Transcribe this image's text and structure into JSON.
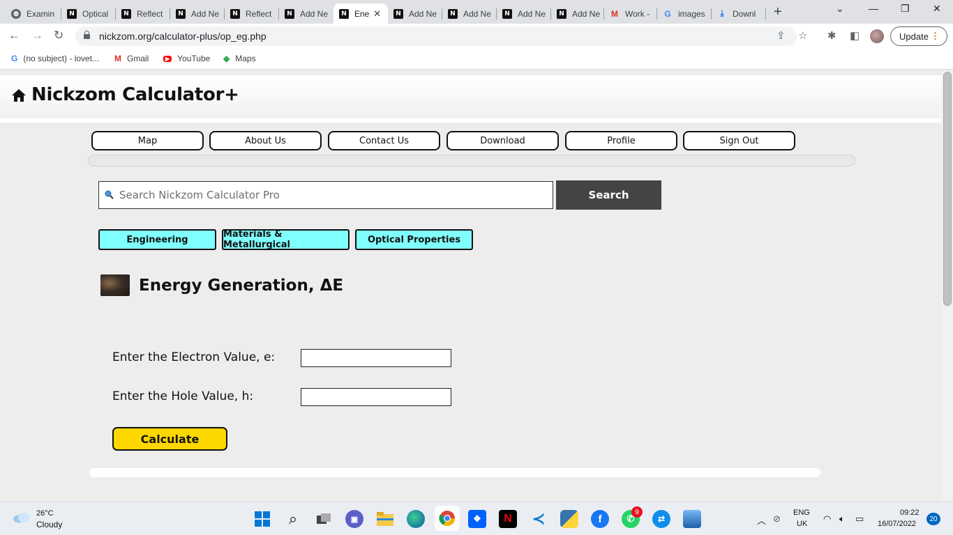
{
  "browser": {
    "tabs": [
      {
        "title": "Examin",
        "icon": "globe"
      },
      {
        "title": "Optical",
        "icon": "nickzom"
      },
      {
        "title": "Reflect",
        "icon": "nickzom"
      },
      {
        "title": "Add Ne",
        "icon": "nickzom"
      },
      {
        "title": "Reflect",
        "icon": "nickzom"
      },
      {
        "title": "Add Ne",
        "icon": "nickzom"
      },
      {
        "title": "Ene",
        "icon": "nickzom",
        "active": true
      },
      {
        "title": "Add Ne",
        "icon": "nickzom"
      },
      {
        "title": "Add Ne",
        "icon": "nickzom"
      },
      {
        "title": "Add Ne",
        "icon": "nickzom"
      },
      {
        "title": "Add Ne",
        "icon": "nickzom"
      },
      {
        "title": "Work -",
        "icon": "gmail"
      },
      {
        "title": "images",
        "icon": "google"
      },
      {
        "title": "Downl",
        "icon": "download"
      }
    ],
    "url": "nickzom.org/calculator-plus/op_eg.php",
    "update_label": "Update",
    "bookmarks": [
      {
        "label": "(no subject) - lovet...",
        "icon": "google"
      },
      {
        "label": "Gmail",
        "icon": "gmail"
      },
      {
        "label": "YouTube",
        "icon": "youtube"
      },
      {
        "label": "Maps",
        "icon": "maps"
      }
    ]
  },
  "site": {
    "title": "Nickzom Calculator+",
    "nav": [
      "Map",
      "About Us",
      "Contact Us",
      "Download",
      "Profile",
      "Sign Out"
    ],
    "search": {
      "placeholder": "Search Nickzom Calculator Pro",
      "button": "Search"
    },
    "categories": [
      "Engineering",
      "Materials & Metallurgical",
      "Optical Properties"
    ],
    "calculator": {
      "title": "Energy Generation, ΔE",
      "fields": [
        {
          "label": "Enter the Electron Value, e:",
          "value": ""
        },
        {
          "label": "Enter the Hole Value, h:",
          "value": ""
        }
      ],
      "button": "Calculate"
    }
  },
  "taskbar": {
    "weather_temp": "26°C",
    "weather_desc": "Cloudy",
    "whatsapp_badge": "9",
    "lang": "ENG",
    "region": "UK",
    "time": "09:22",
    "date": "16/07/2022",
    "notifications": "20"
  }
}
